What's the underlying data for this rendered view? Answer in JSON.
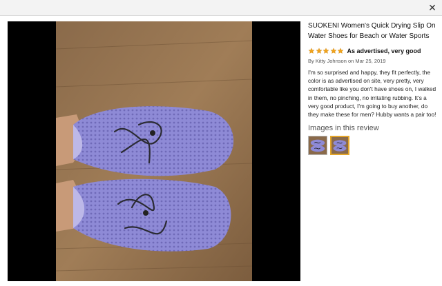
{
  "modal": {
    "close_symbol": "✕"
  },
  "product": {
    "title": "SUOKENI Women's Quick Drying Slip On Water Shoes for Beach or Water Sports"
  },
  "review": {
    "rating": 5,
    "max_rating": 5,
    "star_color": "#f0a31c",
    "headline": "As advertised, very good",
    "byline": "By Kitty Johnson on Mar 25, 2019",
    "body": "I'm so surprised and happy, they fit perfectly, the color is as advertised on site, very pretty, very comfortable like you don't have shoes on, I walked in them, no pinching, no irritating rubbing. It's a very good product, I'm going to buy another, do they make these for men? Hubby wants a pair too!"
  },
  "images_section": {
    "title": "Images in this review",
    "thumbnails": [
      {
        "name": "thumbnail-1",
        "selected": false
      },
      {
        "name": "thumbnail-2",
        "selected": true
      }
    ],
    "selected_border_color": "#e3a52a"
  }
}
